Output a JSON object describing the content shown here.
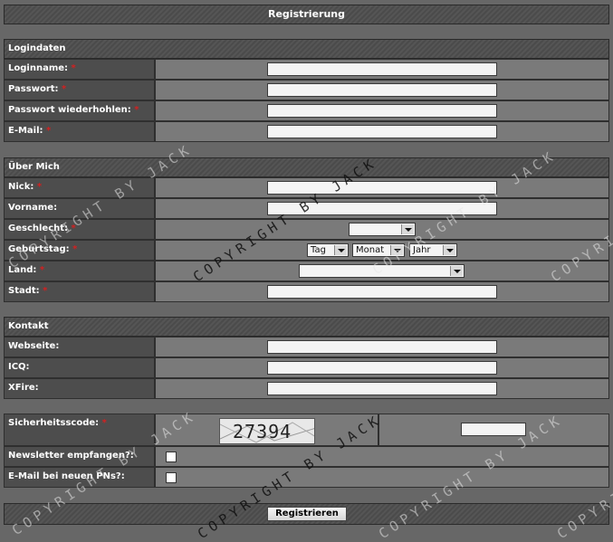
{
  "title": "Registrierung",
  "sections": {
    "logindaten": "Logindaten",
    "ueber_mich": "Über Mich",
    "kontakt": "Kontakt"
  },
  "fields": {
    "loginname": "Loginname:",
    "passwort": "Passwort:",
    "passwort_wdh": "Passwort wiederhohlen:",
    "email": "E-Mail:",
    "nick": "Nick:",
    "vorname": "Vorname:",
    "geschlecht": "Geschlecht:",
    "geburtstag": "Geburtstag:",
    "land": "Land:",
    "stadt": "Stadt:",
    "webseite": "Webseite:",
    "icq": "ICQ:",
    "xfire": "XFire:",
    "sicherheitscode": "Sicherheitsscode:",
    "newsletter": "Newsletter empfangen?:",
    "email_pn": "E-Mail bei neuen PNs?:"
  },
  "required_marker": "*",
  "birthday_selects": {
    "day": "Tag",
    "month": "Monat",
    "year": "Jahr"
  },
  "captcha_text": "27394",
  "submit_label": "Registrieren",
  "watermark": "COPYRIGHT BY JACK",
  "colors": {
    "required": "#d42020",
    "label_bg": "#4d4d4d",
    "value_bg": "#7a7a7a",
    "page_bg": "#676767"
  }
}
